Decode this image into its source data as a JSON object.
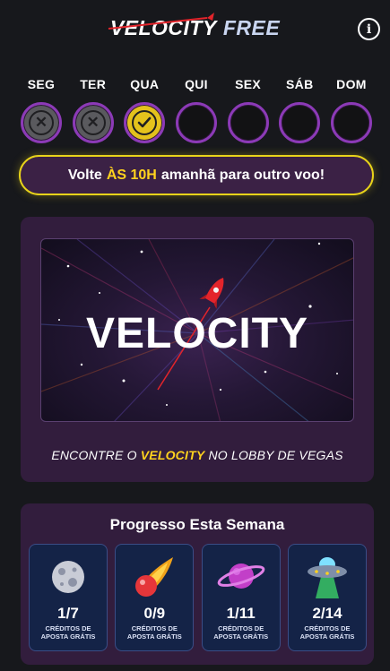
{
  "header": {
    "logo_word1": "VELOCITY",
    "logo_word2": "FREE",
    "info_icon": "info-icon"
  },
  "week": {
    "days": [
      {
        "label": "SEG",
        "status": "missed"
      },
      {
        "label": "TER",
        "status": "missed"
      },
      {
        "label": "QUA",
        "status": "claimed"
      },
      {
        "label": "QUI",
        "status": "pending"
      },
      {
        "label": "SEX",
        "status": "pending"
      },
      {
        "label": "SÁB",
        "status": "pending"
      },
      {
        "label": "DOM",
        "status": "pending"
      }
    ]
  },
  "banner": {
    "before": "Volte",
    "highlight": "ÀS 10H",
    "after": "amanhã para outro voo!"
  },
  "promo": {
    "wordmark": "VELOCITY",
    "caption_before": "ENCONTRE O",
    "caption_highlight": "VELOCITY",
    "caption_after": "NO LOBBY DE VEGAS"
  },
  "progress": {
    "title": "Progresso Esta Semana",
    "tiles": [
      {
        "icon": "asteroid-icon",
        "count": "1/7",
        "label": "CRÉDITOS DE APOSTA GRÁTIS"
      },
      {
        "icon": "meteor-icon",
        "count": "0/9",
        "label": "CRÉDITOS DE APOSTA GRÁTIS"
      },
      {
        "icon": "planet-icon",
        "count": "1/11",
        "label": "CRÉDITOS DE APOSTA GRÁTIS"
      },
      {
        "icon": "ufo-icon",
        "count": "2/14",
        "label": "CRÉDITOS DE APOSTA GRÁTIS"
      }
    ]
  },
  "colors": {
    "accent_yellow": "#ffd21e",
    "ring_purple": "#8c3ab7",
    "card_bg": "#321d3d",
    "tile_bg": "#142347",
    "page_bg": "#17181c"
  }
}
